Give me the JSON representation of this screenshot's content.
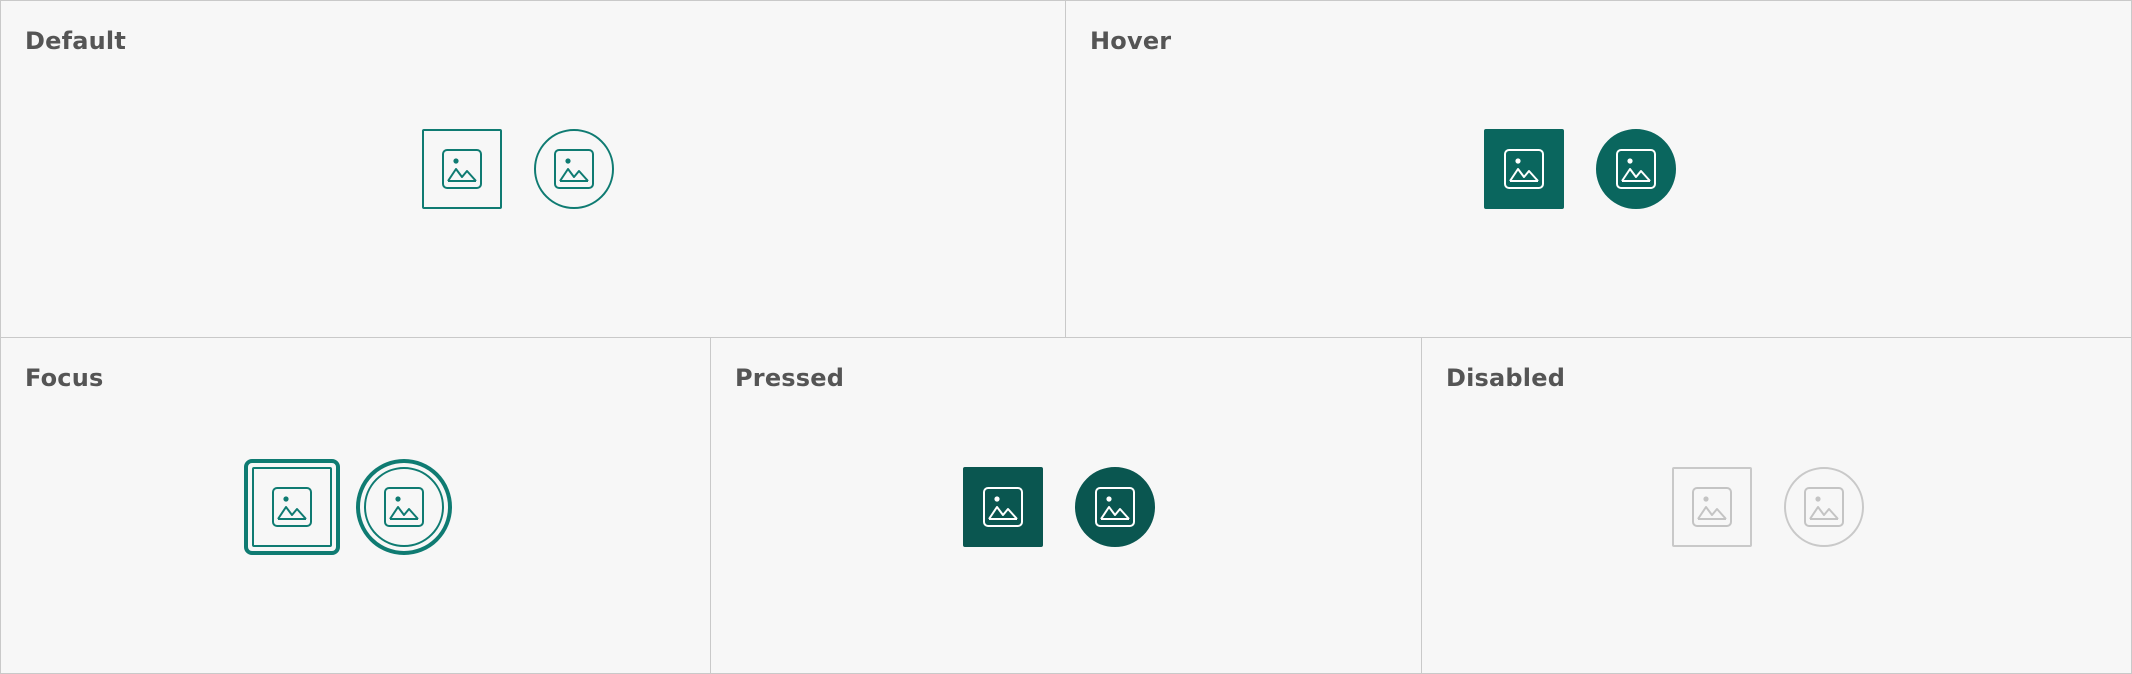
{
  "panels": {
    "default": {
      "title": "Default"
    },
    "hover": {
      "title": "Hover"
    },
    "focus": {
      "title": "Focus"
    },
    "pressed": {
      "title": "Pressed"
    },
    "disabled": {
      "title": "Disabled"
    }
  },
  "icon": "image-icon",
  "colors": {
    "accent": "#0f7b72",
    "hover": "#0a665e",
    "pressed": "#0a5650",
    "disabled": "#c9c9c9",
    "title_text": "#555555",
    "background": "#f7f7f7"
  }
}
